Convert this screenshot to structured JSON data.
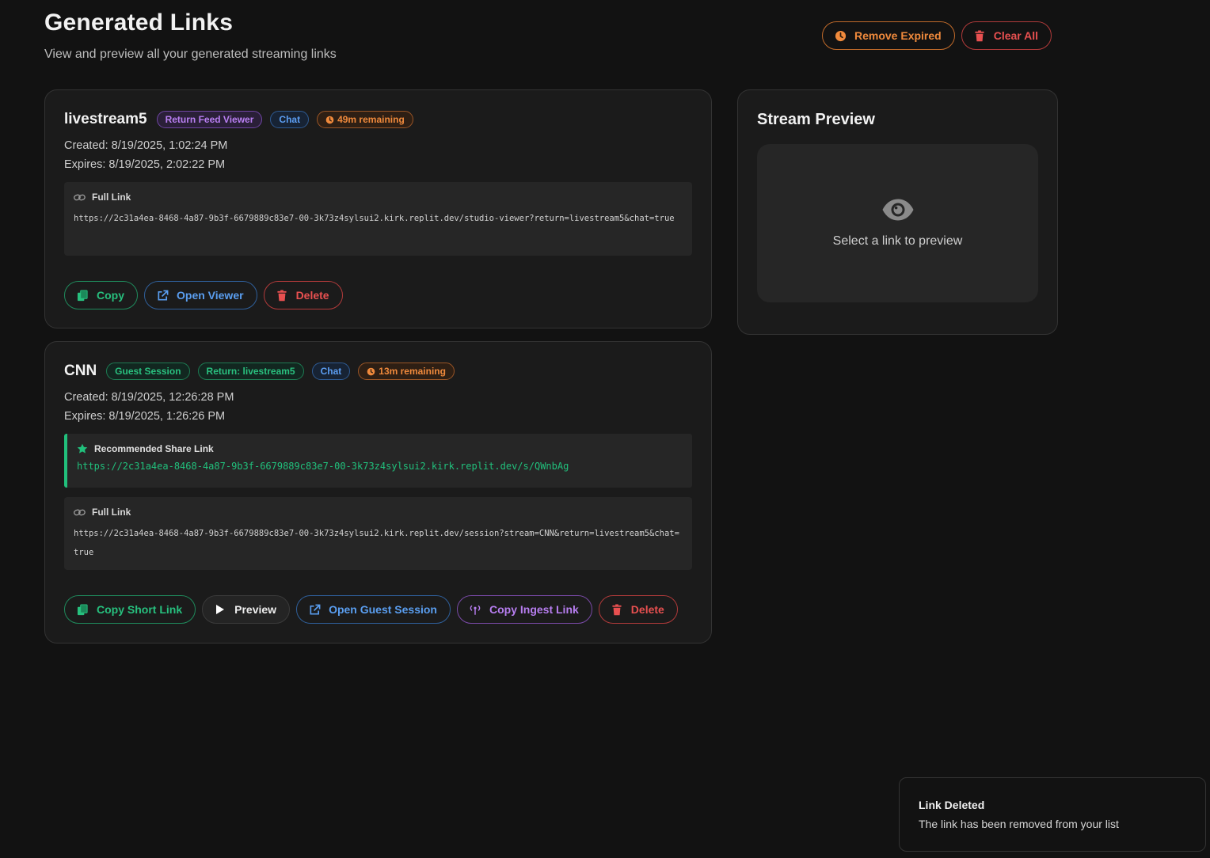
{
  "header": {
    "title": "Generated Links",
    "subtitle": "View and preview all your generated streaming links",
    "remove_expired_label": "Remove Expired",
    "clear_all_label": "Clear All"
  },
  "links": [
    {
      "name": "livestream5",
      "badges": [
        "Return Feed Viewer",
        "Chat",
        "49m remaining"
      ],
      "created": "Created: 8/19/2025, 1:02:24 PM",
      "expires": "Expires: 8/19/2025, 2:02:22 PM",
      "full_link_label": "Full Link",
      "full_link": "https://2c31a4ea-8468-4a87-9b3f-6679889c83e7-00-3k73z4sylsui2.kirk.replit.dev/studio-viewer?return=livestream5&chat=true",
      "actions": [
        "Copy",
        "Open Viewer",
        "Delete"
      ]
    },
    {
      "name": "CNN",
      "badges": [
        "Guest Session",
        "Return: livestream5",
        "Chat",
        "13m remaining"
      ],
      "created": "Created: 8/19/2025, 12:26:28 PM",
      "expires": "Expires: 8/19/2025, 1:26:26 PM",
      "share_link_label": "Recommended Share Link",
      "share_link": "https://2c31a4ea-8468-4a87-9b3f-6679889c83e7-00-3k73z4sylsui2.kirk.replit.dev/s/QWnbAg",
      "full_link_label": "Full Link",
      "full_link": "https://2c31a4ea-8468-4a87-9b3f-6679889c83e7-00-3k73z4sylsui2.kirk.replit.dev/session?stream=CNN&return=livestream5&chat=true",
      "actions": [
        "Copy Short Link",
        "Preview",
        "Open Guest Session",
        "Copy Ingest Link",
        "Delete"
      ]
    }
  ],
  "preview": {
    "title": "Stream Preview",
    "empty_text": "Select a link to preview"
  },
  "toast": {
    "title": "Link Deleted",
    "message": "The link has been removed from your list"
  },
  "colors": {
    "background": "#121212",
    "card": "#1b1b1b",
    "green": "#21c07c",
    "blue": "#5a9ef0",
    "red": "#e85050",
    "orange": "#f08a3c",
    "purple": "#b77ef0"
  },
  "icons": {
    "remove_expired": "clock-icon",
    "clear_all": "trash-icon",
    "copy": "copy-icon",
    "open": "external-link-icon",
    "delete": "trash-icon",
    "link": "link-icon",
    "share": "star-icon",
    "preview": "play-icon",
    "ingest": "broadcast-icon",
    "empty_preview": "eye-icon"
  }
}
